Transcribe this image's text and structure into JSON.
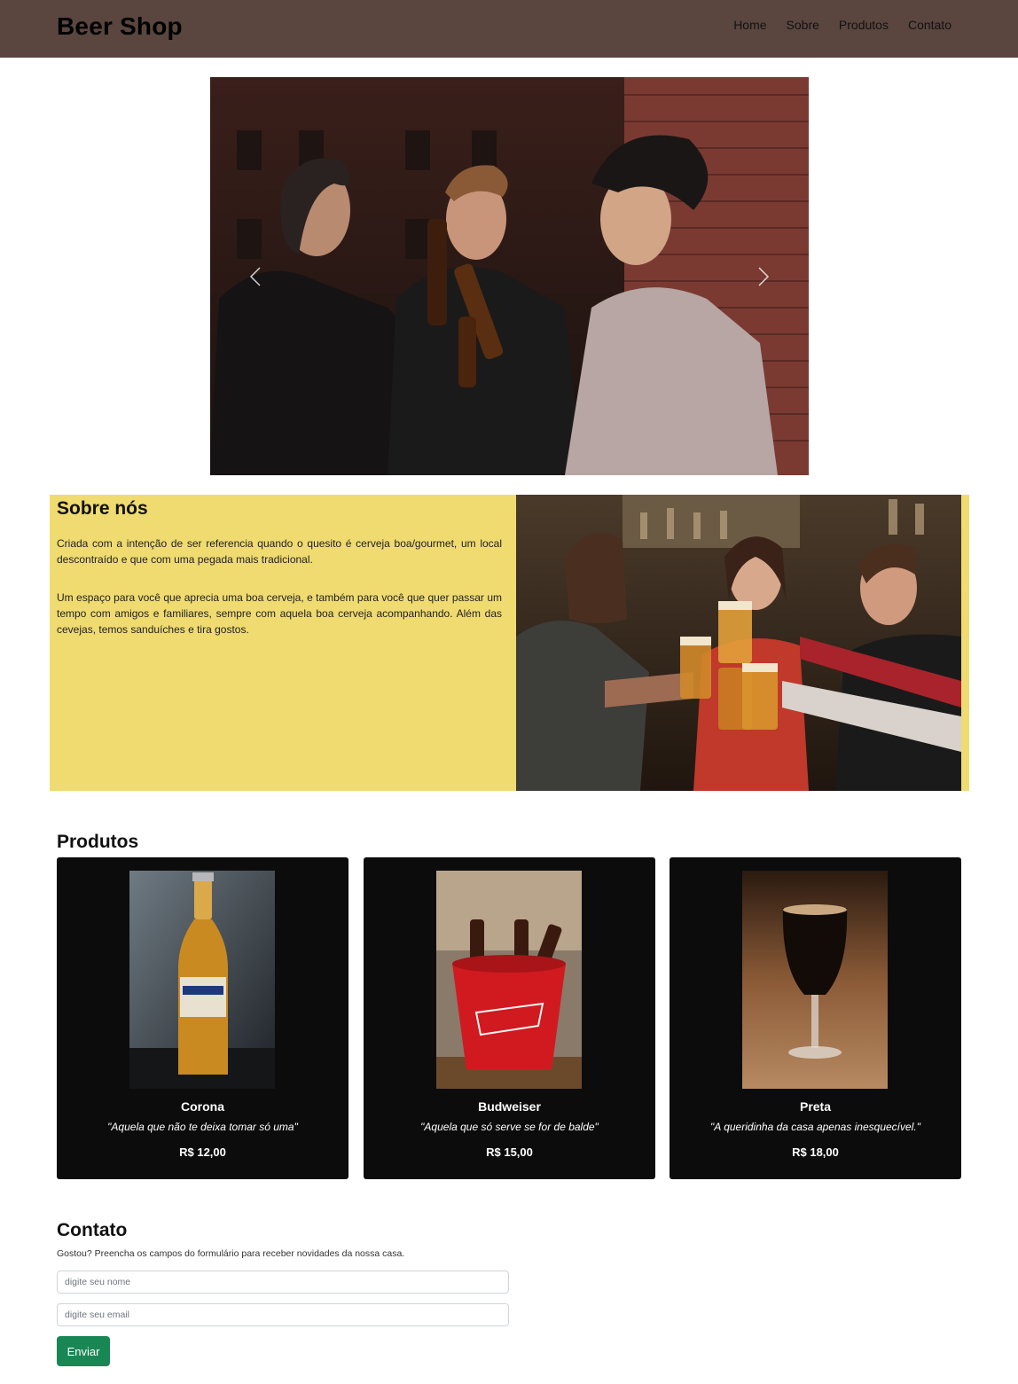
{
  "navbar": {
    "brand": "Beer Shop",
    "links": [
      "Home",
      "Sobre",
      "Produtos",
      "Contato"
    ],
    "background": "#5a463f"
  },
  "carousel": {
    "prev_icon": "chevron-left-icon",
    "next_icon": "chevron-right-icon"
  },
  "sobre": {
    "title": "Sobre nós",
    "paragraph1": "Criada com a intenção de ser referencia quando o quesito é cerveja boa/gourmet, um local descontraído e que com uma pegada mais tradicional.",
    "paragraph2": "Um espaço para você que aprecia uma boa cerveja, e também para você que quer passar um tempo com amigos e familiares, sempre com aquela boa cerveja acompanhando. Além das cevejas, temos sanduíches e tira gostos.",
    "background": "#efdb70"
  },
  "produtos": {
    "title": "Produtos",
    "items": [
      {
        "name": "Corona",
        "description": "\"Aquela que não te deixa tomar só uma\"",
        "price": "R$ 12,00"
      },
      {
        "name": "Budweiser",
        "description": "\"Aquela que só serve se for de balde\"",
        "price": "R$ 15,00"
      },
      {
        "name": "Preta",
        "description": "\"A queridinha da casa apenas inesquecível.\"",
        "price": "R$ 18,00"
      }
    ]
  },
  "contato": {
    "title": "Contato",
    "subtitle": "Gostou? Preencha os campos do formulário para receber novidades da nossa casa.",
    "name_placeholder": "digite seu nome",
    "email_placeholder": "digite seu email",
    "submit_label": "Enviar",
    "button_color": "#198754"
  }
}
